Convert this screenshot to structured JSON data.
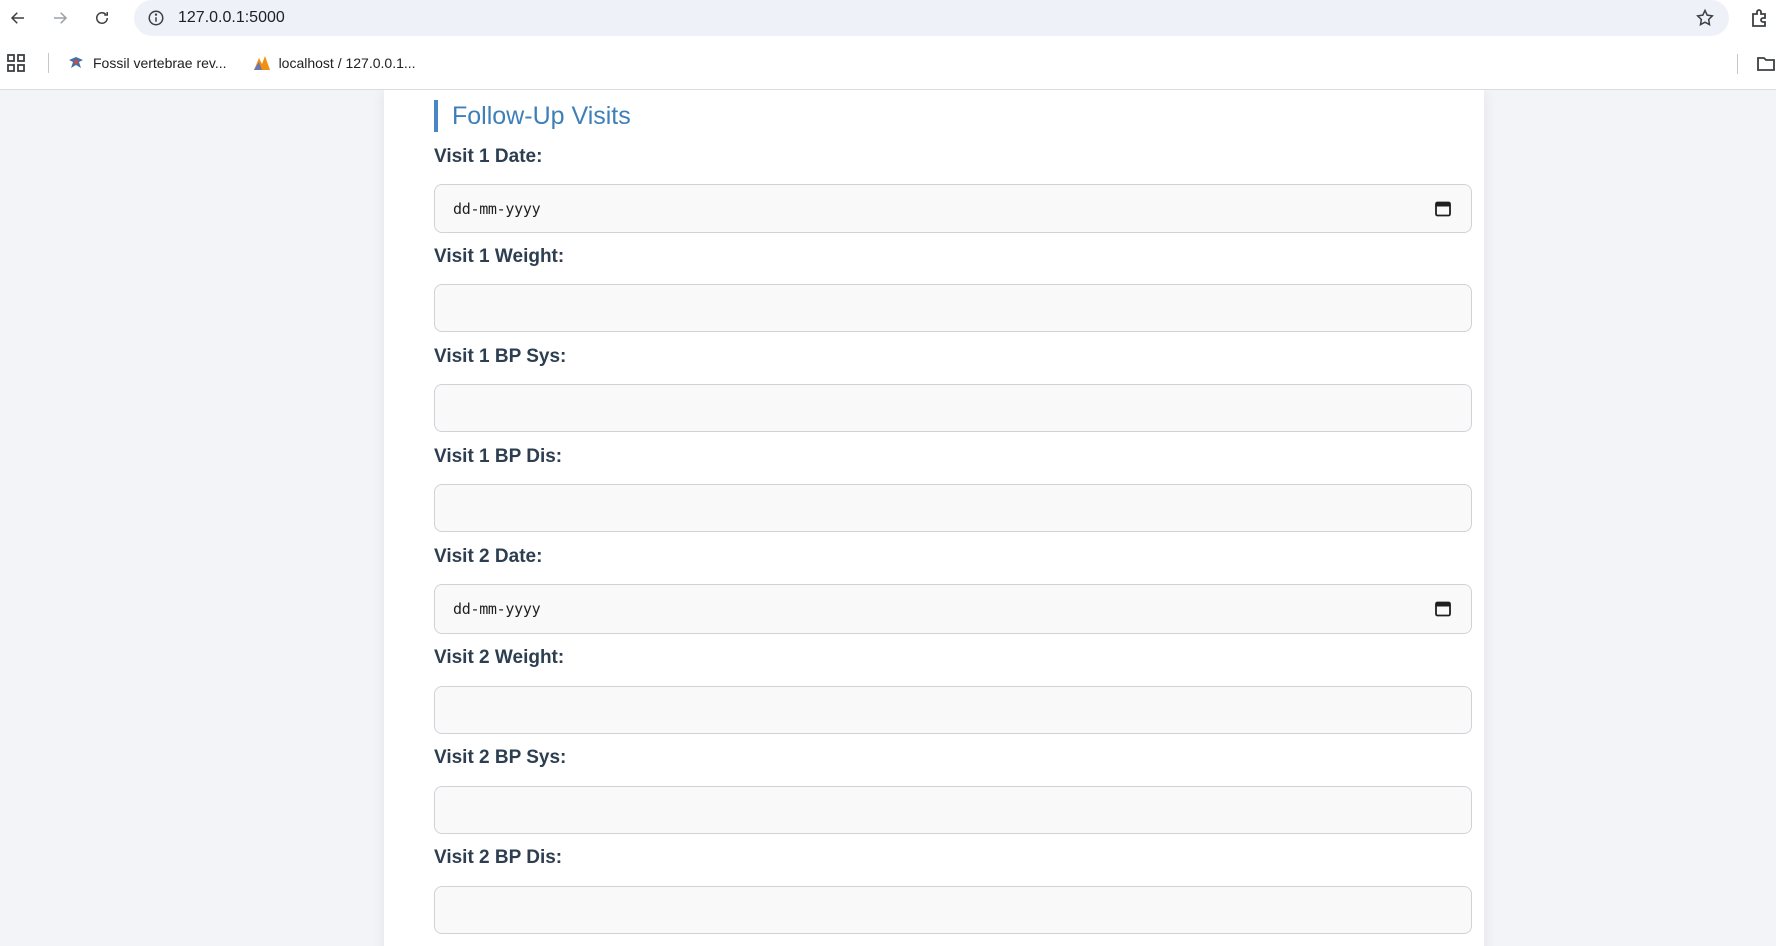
{
  "browser": {
    "url": "127.0.0.1:5000",
    "bookmarks": [
      {
        "label": "Fossil vertebrae rev..."
      },
      {
        "label": "localhost / 127.0.0.1..."
      }
    ]
  },
  "section": {
    "title": "Follow-Up Visits"
  },
  "fields": {
    "visit1_date": {
      "label": "Visit 1 Date:",
      "placeholder": "dd-mm-yyyy"
    },
    "visit1_weight": {
      "label": "Visit 1 Weight:",
      "value": ""
    },
    "visit1_bp_sys": {
      "label": "Visit 1 BP Sys:",
      "value": ""
    },
    "visit1_bp_dis": {
      "label": "Visit 1 BP Dis:",
      "value": ""
    },
    "visit2_date": {
      "label": "Visit 2 Date:",
      "placeholder": "dd-mm-yyyy"
    },
    "visit2_weight": {
      "label": "Visit 2 Weight:",
      "value": ""
    },
    "visit2_bp_sys": {
      "label": "Visit 2 BP Sys:",
      "value": ""
    },
    "visit2_bp_dis": {
      "label": "Visit 2 BP Dis:",
      "value": ""
    }
  },
  "colors": {
    "accent": "#4a86c5",
    "section_title": "#3f7fb8",
    "label": "#2c3e50",
    "input_bg": "#f9f9f9",
    "page_bg": "#f2f4f8"
  }
}
